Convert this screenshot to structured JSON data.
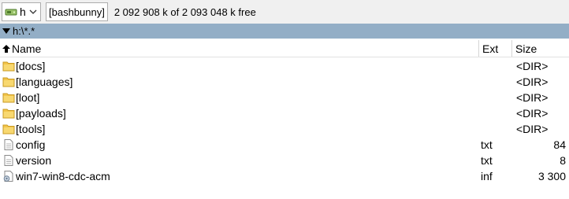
{
  "drive": {
    "letter": "h",
    "volume_label": "[bashbunny]",
    "free_space": "2 092 908 k of 2 093 048 k free"
  },
  "path": "h:\\*.*",
  "columns": {
    "name": "Name",
    "ext": "Ext",
    "size": "Size"
  },
  "files": [
    {
      "name": "[docs]",
      "ext": "",
      "size": "<DIR>",
      "type": "folder"
    },
    {
      "name": "[languages]",
      "ext": "",
      "size": "<DIR>",
      "type": "folder"
    },
    {
      "name": "[loot]",
      "ext": "",
      "size": "<DIR>",
      "type": "folder"
    },
    {
      "name": "[payloads]",
      "ext": "",
      "size": "<DIR>",
      "type": "folder"
    },
    {
      "name": "[tools]",
      "ext": "",
      "size": "<DIR>",
      "type": "folder"
    },
    {
      "name": "config",
      "ext": "txt",
      "size": "84",
      "type": "text-file"
    },
    {
      "name": "version",
      "ext": "txt",
      "size": "8",
      "type": "text-file"
    },
    {
      "name": "win7-win8-cdc-acm",
      "ext": "inf",
      "size": "3 300",
      "type": "inf-file"
    }
  ],
  "icons": {
    "drive": "usb-drive-icon",
    "dropdown": "chevron-down-icon",
    "path": "triangle-down-icon",
    "sort": "sort-up-arrow-icon",
    "folder": "folder-icon",
    "text": "text-file-icon",
    "inf": "settings-file-icon"
  },
  "colors": {
    "path_bar": "#93aec6",
    "folder": "#f3c54b"
  }
}
